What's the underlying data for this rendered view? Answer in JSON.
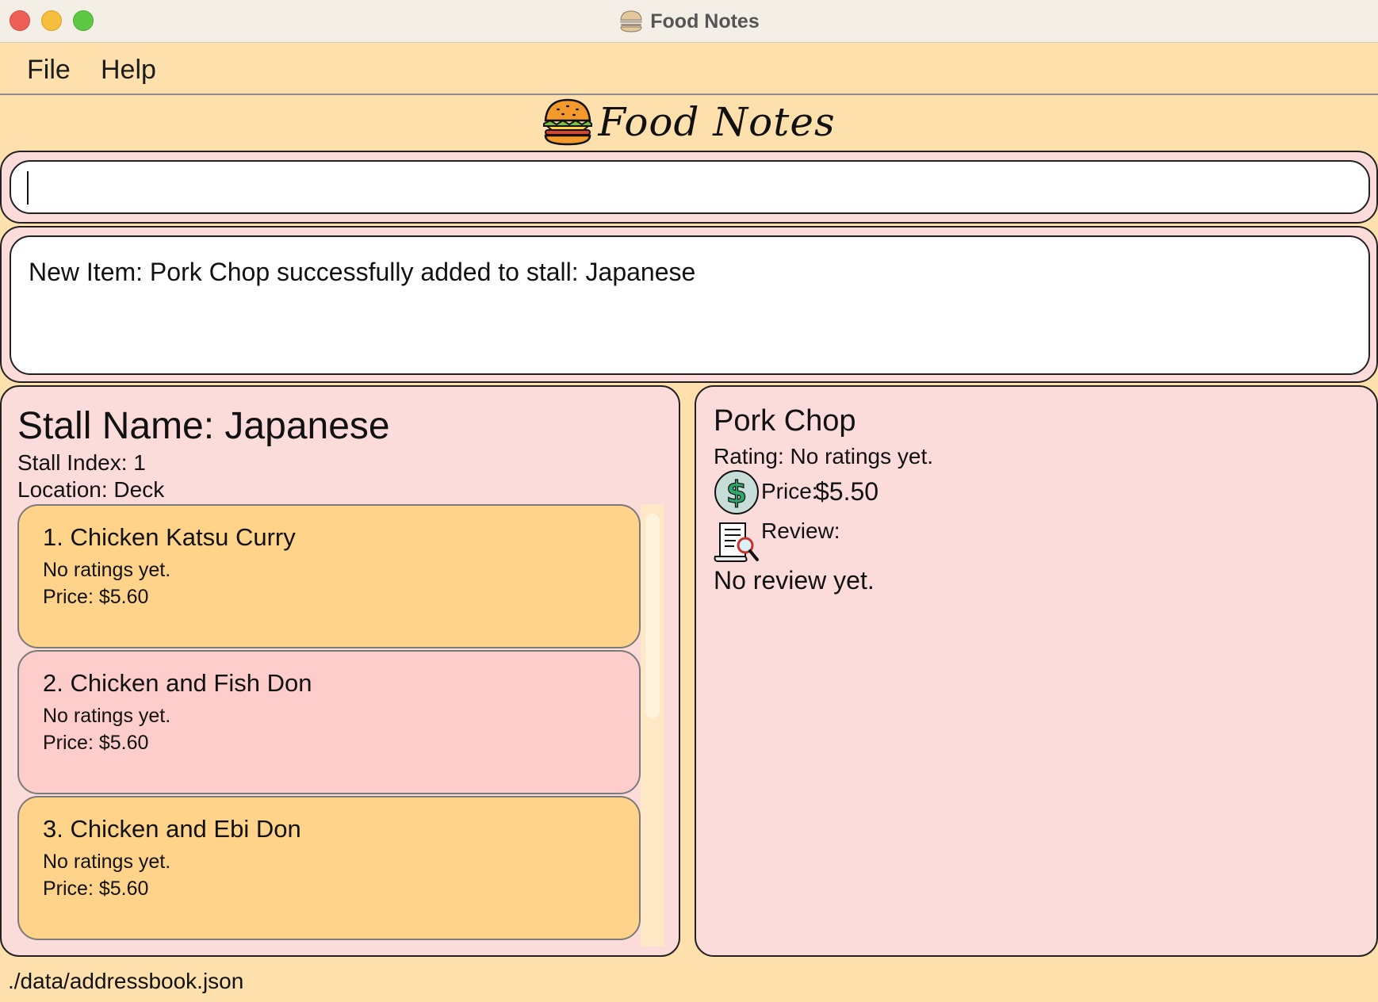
{
  "window": {
    "title": "Food Notes",
    "icon": "burger-icon"
  },
  "menu": {
    "file": "File",
    "help": "Help"
  },
  "logo": {
    "text": "Food Notes",
    "icon": "burger-icon"
  },
  "command": {
    "value": ""
  },
  "result": {
    "message": "New Item: Pork Chop successfully added to stall: Japanese"
  },
  "stall": {
    "name": "Stall Name: Japanese",
    "index": "Stall Index: 1",
    "location": "Location: Deck",
    "items": [
      {
        "title": "1.  Chicken Katsu Curry",
        "rating": "No ratings yet.",
        "price": "Price: $5.60"
      },
      {
        "title": "2.  Chicken and Fish Don",
        "rating": "No ratings yet.",
        "price": "Price: $5.60"
      },
      {
        "title": "3.  Chicken and Ebi Don",
        "rating": "No ratings yet.",
        "price": "Price: $5.60"
      }
    ]
  },
  "detail": {
    "name": "Pork Chop",
    "rating": "Rating: No ratings yet.",
    "price_label": "Price:",
    "price_value": "$5.50",
    "review_label": "Review:",
    "review_text": "No review yet.",
    "icons": [
      "dollar-icon",
      "review-magnifier-icon"
    ]
  },
  "status": {
    "path": "./data/addressbook.json"
  },
  "colors": {
    "background": "#FEE0AC",
    "panel": "#FCDCDA",
    "card_odd": "#FFD48A",
    "card_even": "#FCCDCA"
  }
}
